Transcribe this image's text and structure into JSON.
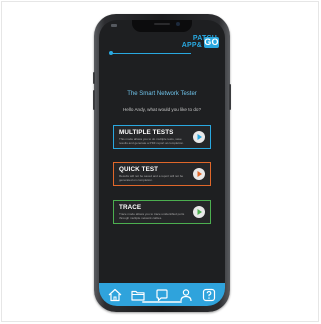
{
  "app": {
    "logo_line1": "PATCH",
    "logo_line2": "APP&",
    "logo_badge": "GO",
    "title": "The Smart Network Tester",
    "greeting": "Hello Andy, what would you like to do?"
  },
  "options": [
    {
      "title": "MULTIPLE TESTS",
      "description": "This mode allows you to do multiple tests, save results and generate a PDF report at completion.",
      "accent": "#29a8e0"
    },
    {
      "title": "QUICK TEST",
      "description": "Results will not be saved and a report will not be generated on completion.",
      "accent": "#e0672a"
    },
    {
      "title": "TRACE",
      "description": "Trace mode allows you to trace unidentified ports through multiple network cables.",
      "accent": "#4caf50"
    }
  ],
  "tabs": [
    {
      "icon": "home-icon"
    },
    {
      "icon": "folder-icon"
    },
    {
      "icon": "chat-icon"
    },
    {
      "icon": "user-icon"
    },
    {
      "icon": "help-icon"
    }
  ],
  "colors": {
    "brand": "#29a8e0",
    "tabbar": "#2fa3dc",
    "screen_bg": "#1e1f21"
  }
}
